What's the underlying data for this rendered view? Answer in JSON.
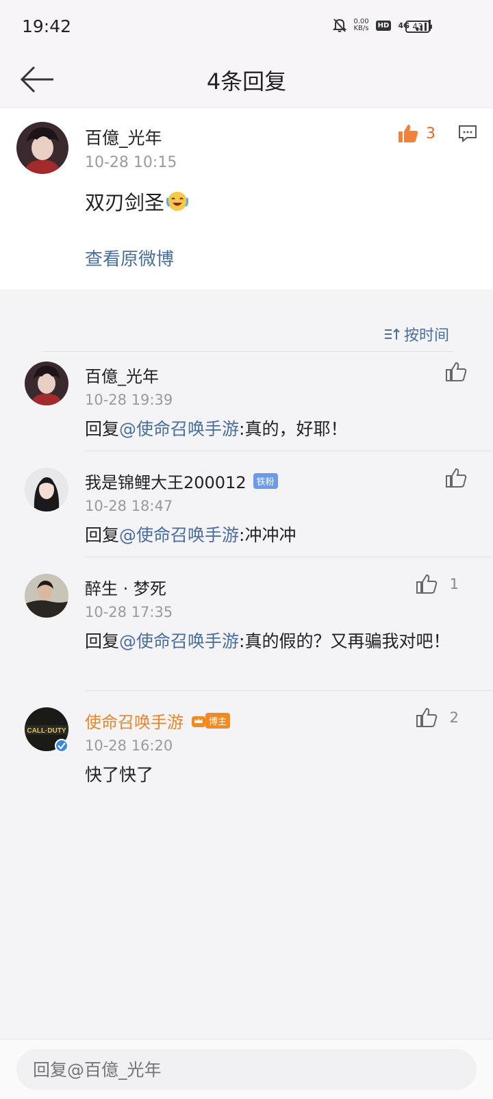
{
  "status_bar": {
    "time": "19:42",
    "net_speed_value": "0.00",
    "net_speed_unit": "KB/s",
    "hd_label": "HD",
    "network": "4G",
    "battery": "43",
    "icons": [
      "mute-bell-icon",
      "signal-icon",
      "battery-icon"
    ]
  },
  "nav": {
    "title": "4条回复",
    "back_icon": "arrow-left-icon"
  },
  "main_comment": {
    "user": "百億_光年",
    "time": "10-28  10:15",
    "text": "双刃剑圣",
    "emoji": "laughing-tears-emoji",
    "likes": "3",
    "view_original": "查看原微博",
    "like_color": "#e8642a"
  },
  "sort": {
    "label": "按时间"
  },
  "replies": [
    {
      "user": "百億_光年",
      "time": "10-28  19:39",
      "mention": "@使命召唤手游",
      "text": ":真的，好耶！",
      "prefix": "回复",
      "likes": ""
    },
    {
      "user": "我是锦鲤大王200012",
      "badge": "铁粉",
      "time": "10-28  18:47",
      "mention": "@使命召唤手游",
      "text": ":冲冲冲",
      "prefix": "回复",
      "likes": ""
    },
    {
      "user": "醉生 · 梦死",
      "time": "10-28  17:35",
      "mention": "@使命召唤手游",
      "text": ":真的假的？又再骗我对吧！",
      "prefix": "回复",
      "likes": "1"
    },
    {
      "user": "使命召唤手游",
      "badge": "博主",
      "time": "10-28  16:20",
      "text": "快了快了",
      "likes": "2",
      "avatar_text": "CALL·DUTY"
    }
  ],
  "input": {
    "placeholder": "回复@百億_光年"
  },
  "colors": {
    "link": "#4a6e9c",
    "official_name": "#e8852a",
    "background": "#f4f3f6"
  }
}
